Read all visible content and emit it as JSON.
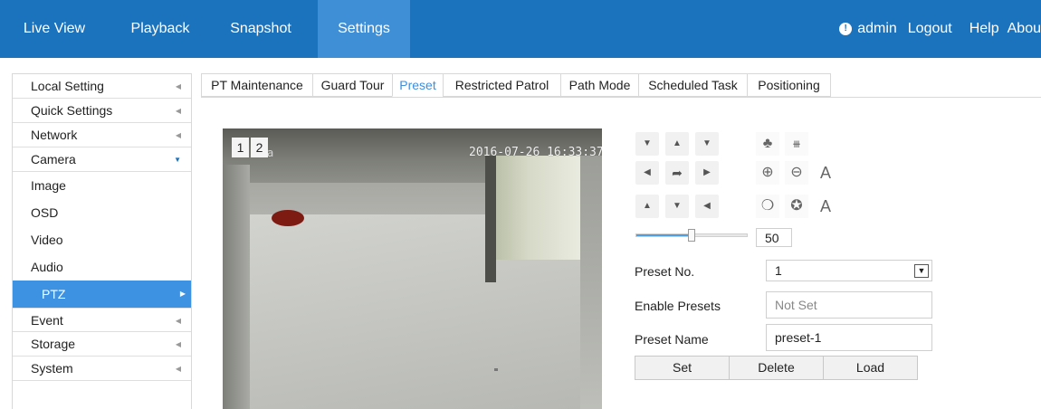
{
  "nav": {
    "items": [
      {
        "label": "Live View"
      },
      {
        "label": "Playback"
      },
      {
        "label": "Snapshot"
      },
      {
        "label": "Settings"
      }
    ],
    "active": "Settings",
    "user": "admin",
    "logout": "Logout",
    "help": "Help",
    "about": "Abou"
  },
  "sidebar": {
    "items": [
      {
        "label": "Local Setting"
      },
      {
        "label": "Quick Settings"
      },
      {
        "label": "Network"
      },
      {
        "label": "Camera"
      },
      {
        "label": "Event"
      },
      {
        "label": "Storage"
      },
      {
        "label": "System"
      }
    ],
    "camera_sub": [
      {
        "label": "Image"
      },
      {
        "label": "OSD"
      },
      {
        "label": "Video"
      },
      {
        "label": "Audio"
      },
      {
        "label": "PTZ"
      }
    ],
    "selected": "PTZ"
  },
  "tabs": {
    "items": [
      {
        "label": "PT Maintenance"
      },
      {
        "label": "Guard Tour"
      },
      {
        "label": "Preset"
      },
      {
        "label": "Restricted Patrol"
      },
      {
        "label": "Path Mode"
      },
      {
        "label": "Scheduled Task"
      },
      {
        "label": "Positioning"
      }
    ],
    "active": "Preset"
  },
  "video": {
    "channels": [
      "1",
      "2"
    ],
    "osd_name": "a",
    "osd_time": "2016-07-26 16:33:37"
  },
  "ptz": {
    "icons": [
      "arrow-up-left-icon",
      "arrow-up-icon",
      "arrow-up-right-icon",
      "arrow-left-icon",
      "auto-rotate-icon",
      "arrow-right-icon",
      "arrow-down-left-icon",
      "arrow-down-icon",
      "arrow-down-right-icon"
    ],
    "tool_icons": [
      "wiper-icon",
      "light-icon",
      "zoom-in-icon",
      "zoom-out-icon",
      "auto-focus-icon",
      "iris-open-icon",
      "iris-close-icon",
      "auto-iris-icon"
    ],
    "auto_label": "A",
    "speed": "50",
    "speed_fraction": 0.5
  },
  "preset": {
    "number_label": "Preset No.",
    "number_value": "1",
    "enable_label": "Enable Presets",
    "enable_value": "Not Set",
    "name_label": "Preset Name",
    "name_value": "preset-1"
  },
  "buttons": {
    "set": "Set",
    "delete": "Delete",
    "load": "Load"
  },
  "colors": {
    "nav_bg": "#1b72bd",
    "nav_active": "#3f8fd6",
    "selected_item": "#3d92e2",
    "active_tab_text": "#3d8fdd"
  }
}
